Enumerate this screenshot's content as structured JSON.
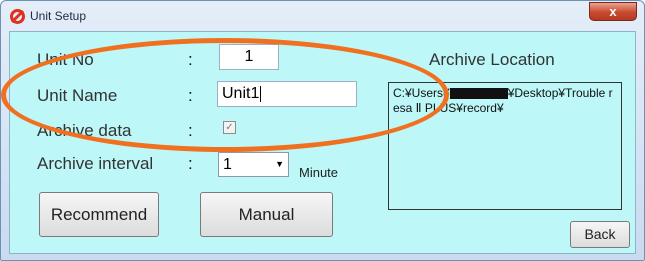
{
  "window": {
    "title": "Unit Setup",
    "close_label": "x"
  },
  "form": {
    "unit_no": {
      "label": "Unit No",
      "colon": ":",
      "value": "1"
    },
    "unit_name": {
      "label": "Unit Name",
      "colon": ":",
      "value": "Unit1"
    },
    "archive_data": {
      "label": "Archive data",
      "colon": ":",
      "checked": true,
      "check_glyph": "✓"
    },
    "archive_interval": {
      "label": "Archive interval",
      "colon": ":",
      "value": "1",
      "unit": "Minute"
    }
  },
  "buttons": {
    "recommend": "Recommend",
    "manual": "Manual",
    "back": "Back"
  },
  "archive": {
    "title": "Archive Location",
    "path_prefix": "C:¥Users¥",
    "path_suffix": "¥Desktop¥Trouble resa Ⅱ PLUS¥record¥"
  },
  "colors": {
    "panel": "#bdf7f7",
    "highlight": "#f07020",
    "app_icon": "#e0301e"
  }
}
